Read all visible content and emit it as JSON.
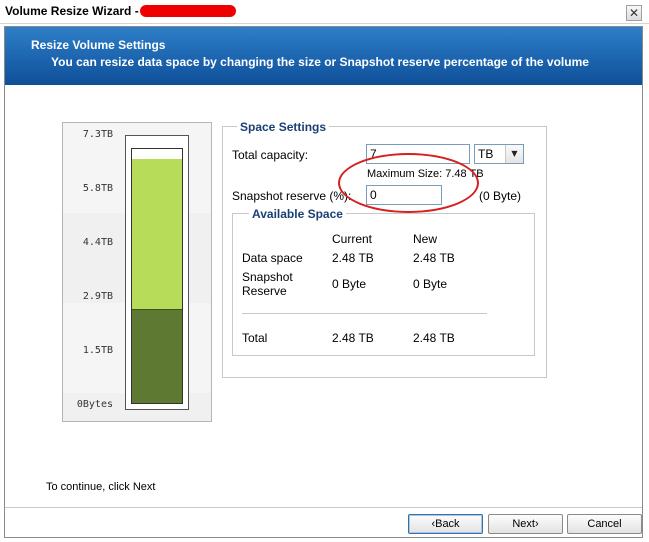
{
  "window": {
    "title": "Volume Resize Wizard -",
    "close_glyph": "✕"
  },
  "banner": {
    "heading": "Resize Volume Settings",
    "subheading": "You can resize data space by changing the size or Snapshot reserve percentage of the volume"
  },
  "gauge": {
    "ticks": [
      "7.3TB",
      "5.8TB",
      "4.4TB",
      "2.9TB",
      "1.5TB",
      "0Bytes"
    ],
    "total_tb": 7,
    "used_tb": 2.48,
    "scale_max_tb": 7.3,
    "colors": {
      "total": "#b6dc5a",
      "used": "#5e7a32"
    }
  },
  "space_settings": {
    "title": "Space Settings",
    "total_capacity_label": "Total capacity:",
    "total_capacity_value": "7",
    "unit_value": "TB",
    "unit_arrow": "▼",
    "max_size_text": "Maximum Size: 7.48 TB",
    "snapshot_label": "Snapshot reserve (%):",
    "snapshot_value": "0",
    "snapshot_bytes": "(0 Byte)"
  },
  "available_space": {
    "title": "Available Space",
    "col_current": "Current",
    "col_new": "New",
    "rows": [
      {
        "label": "Data space",
        "current": "2.48 TB",
        "new": "2.48 TB"
      },
      {
        "label": "Snapshot\nReserve",
        "current": "0 Byte",
        "new": "0 Byte"
      },
      {
        "label": "Total",
        "current": "2.48 TB",
        "new": "2.48 TB"
      }
    ]
  },
  "instruction": "To continue, click Next",
  "buttons": {
    "back": "‹Back",
    "next": "Next›",
    "cancel": "Cancel"
  }
}
